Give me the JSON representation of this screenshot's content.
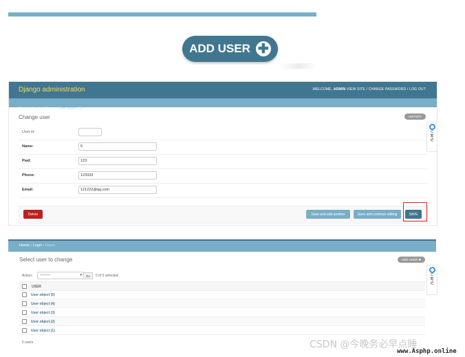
{
  "hero": {
    "add_user_label": "ADD USER",
    "plus": "✚"
  },
  "admin": {
    "brand": "Django administration",
    "welcome": "WELCOME,",
    "username": "ADMIN",
    "user_links": "VIEW SITE / CHANGE PASSWORD / LOG OUT",
    "breadcrumb": {
      "home": "Home",
      "app": "Login",
      "model": "Users",
      "current": "User object (5)",
      "sep": " › "
    },
    "title": "Change user",
    "history": "HISTORY",
    "fields": [
      {
        "label": "User id:",
        "value": ""
      },
      {
        "label": "Name:",
        "value": "5"
      },
      {
        "label": "Pwd:",
        "value": "123"
      },
      {
        "label": "Phone:",
        "value": "123333"
      },
      {
        "label": "Email:",
        "value": "121222@qq.com"
      }
    ],
    "buttons": {
      "delete": "Delete",
      "save_add": "Save and add another",
      "save_continue": "Save and continue editing",
      "save": "SAVE"
    }
  },
  "side_widget": {
    "line1": "C",
    "line2": "笔",
    "line3": "记"
  },
  "changelist": {
    "breadcrumb": {
      "home": "Home",
      "app": "Login",
      "current": "Users",
      "sep": " › "
    },
    "title": "Select user to change",
    "add_user": "ADD USER ✚",
    "action_label": "Action:",
    "action_value": "---------",
    "go": "Go",
    "selected": "0 of 5 selected",
    "column": "USER",
    "rows": [
      "User object (5)",
      "User object (4)",
      "User object (3)",
      "User object (2)",
      "User object (1)"
    ],
    "paginator": "5 users"
  },
  "watermark": {
    "text": "CSDN @今晚务必早点睡",
    "site": "www.Asphp.online"
  },
  "colors": {
    "header": "#417690",
    "breadcrumb": "#79aec8",
    "brand": "#f5dd5d",
    "delete": "#ba2121",
    "highlight": "#e02020"
  }
}
